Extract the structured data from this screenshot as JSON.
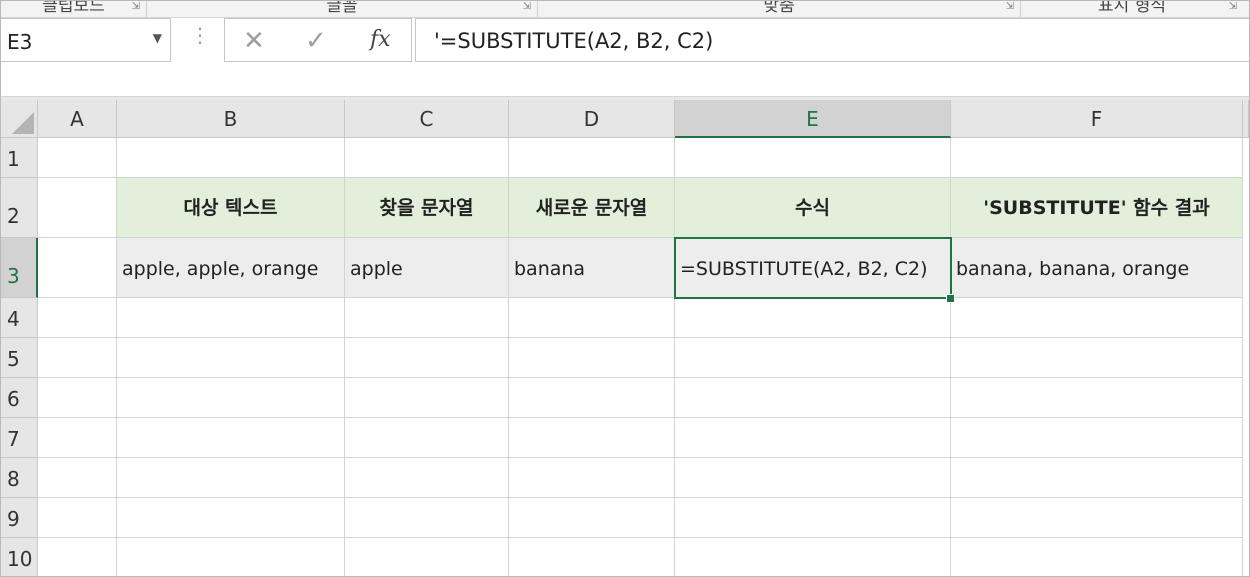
{
  "ribbon": {
    "groups": [
      {
        "label": "클립보드",
        "launcher": "⇲"
      },
      {
        "label": "글꼴",
        "launcher": "⇲"
      },
      {
        "label": "맞춤",
        "launcher": "⇲"
      },
      {
        "label": "표시 형식",
        "launcher": "⇲"
      }
    ]
  },
  "formula_bar": {
    "name_box": "E3",
    "cancel_symbol": "✕",
    "enter_symbol": "✓",
    "fx_label": "fx",
    "content": "'=SUBSTITUTE(A2, B2, C2)"
  },
  "sheet": {
    "columns": [
      "A",
      "B",
      "C",
      "D",
      "E",
      "F"
    ],
    "rows": [
      "1",
      "2",
      "3",
      "4",
      "5",
      "6",
      "7",
      "8",
      "9",
      "10"
    ],
    "active_cell": "E3",
    "header_row": {
      "B": "대상 텍스트",
      "C": "찾을 문자열",
      "D": "새로운 문자열",
      "E": "수식",
      "F": "'SUBSTITUTE' 함수 결과"
    },
    "data_row": {
      "B": "apple, apple, orange",
      "C": "apple",
      "D": "banana",
      "E": "=SUBSTITUTE(A2, B2, C2)",
      "F": "banana, banana, orange"
    }
  },
  "colors": {
    "header_fill": "#e2efda",
    "data_fill": "#ededed",
    "selection": "#217346"
  }
}
